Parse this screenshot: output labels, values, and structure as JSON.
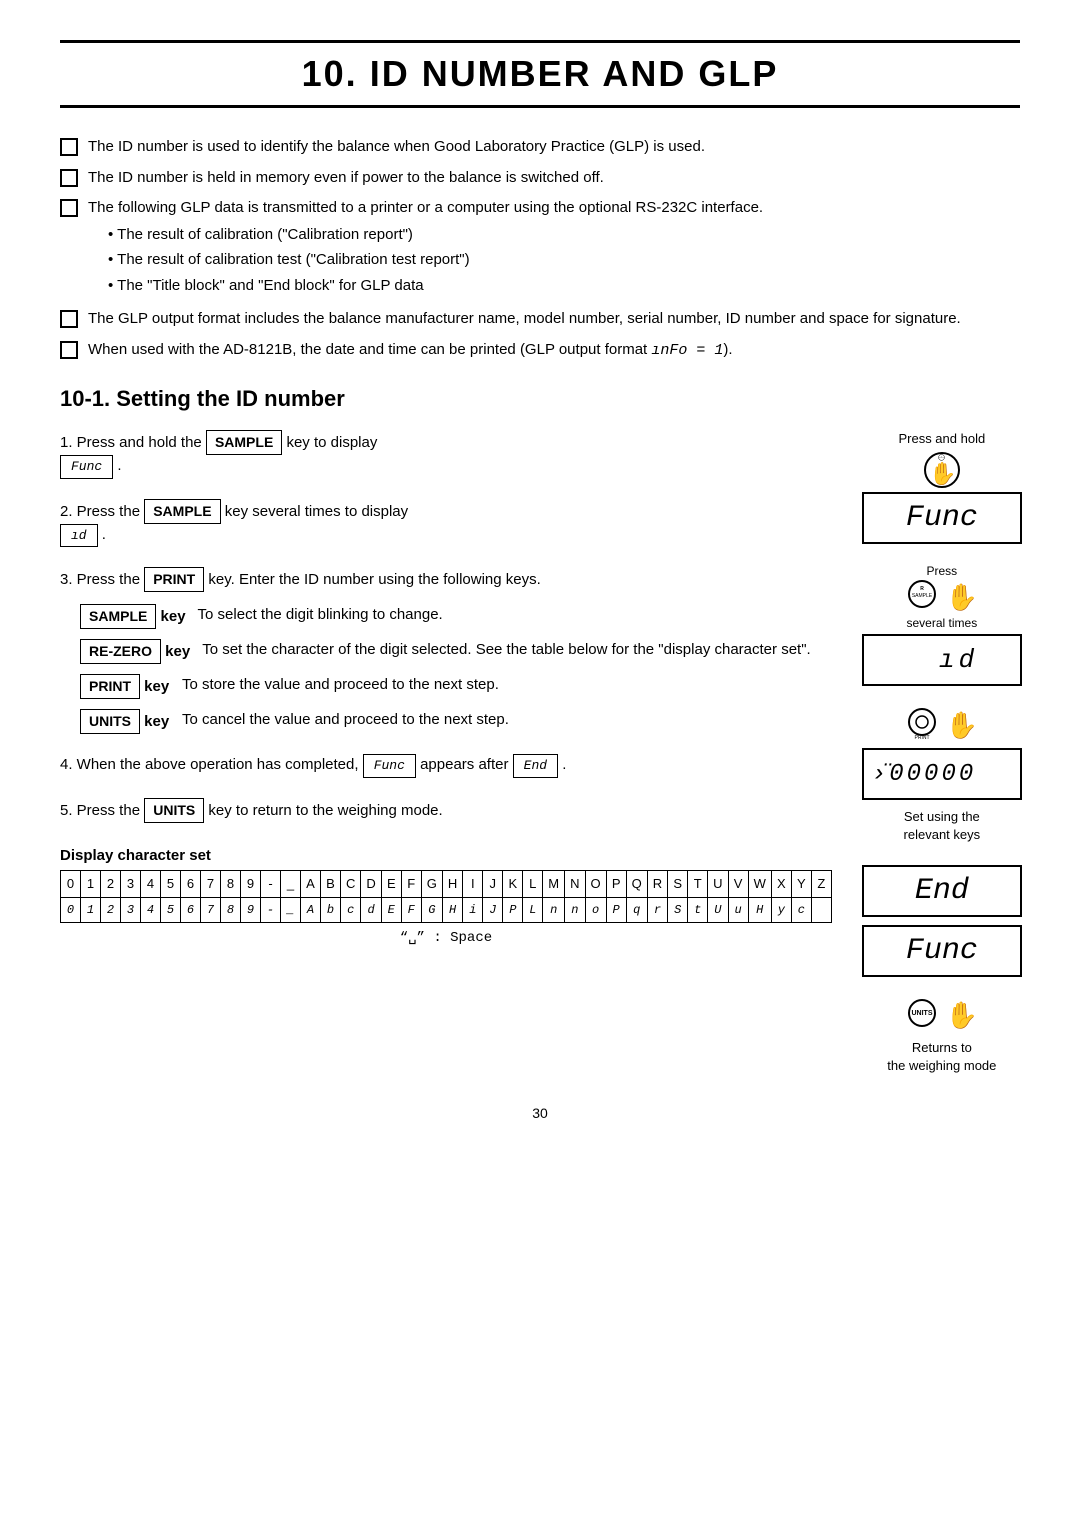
{
  "title": "10. ID NUMBER AND GLP",
  "bullets": [
    {
      "text": "The ID number is used to identify the balance when Good Laboratory Practice (GLP) is used."
    },
    {
      "text": "The ID number is held in memory even if power to the balance is switched off."
    },
    {
      "text": "The following GLP data is transmitted to a printer or a computer using the optional RS-232C interface.",
      "subbullets": [
        "The result of calibration (\"Calibration report\")",
        "The result of calibration test (\"Calibration test report\")",
        "The \"Title block\" and \"End block\" for GLP data"
      ]
    },
    {
      "text": "The GLP output format includes the balance manufacturer name, model number, serial number, ID number and space for signature."
    },
    {
      "text": "When used with the AD-8121B, the date and time can be printed (GLP output format ᵢnF₀ = 1)."
    }
  ],
  "section_heading": "10-1. Setting the ID number",
  "steps": [
    {
      "num": "1",
      "text_before": "Press and hold the",
      "key": "SAMPLE",
      "text_after": "key to display",
      "display": "Func"
    },
    {
      "num": "2",
      "text_before": "Press the",
      "key": "SAMPLE",
      "text_after": "key several times to display",
      "display": "id"
    },
    {
      "num": "3",
      "text_before": "Press the",
      "key": "PRINT",
      "text_after": "key. Enter the ID number using the following keys.",
      "key_table": [
        {
          "key": "SAMPLE",
          "suffix": "key",
          "desc": "To select the digit blinking to change."
        },
        {
          "key": "RE-ZERO",
          "suffix": "key",
          "desc": "To set the character of the digit selected. See the table below for the \"display character set\"."
        },
        {
          "key": "PRINT",
          "suffix": "key",
          "desc": "To store the value and proceed to the next step."
        },
        {
          "key": "UNITS",
          "suffix": "key",
          "desc": "To cancel the value and proceed to the next step."
        }
      ]
    },
    {
      "num": "4",
      "text": "When the above operation has completed,",
      "func_display": "Func",
      "text2": "appears after",
      "end_display": "End"
    },
    {
      "num": "5",
      "text_before": "Press the",
      "key": "UNITS",
      "text_after": "key to return to the weighing mode."
    }
  ],
  "right_column": {
    "press_and_hold_label": "Press and hold",
    "lcd_func": "Func",
    "press_label": "Press",
    "several_times_label": "several times",
    "lcd_id": "id",
    "set_using_label": "Set using the",
    "relevant_keys_label": "relevant keys",
    "lcd_end": "End",
    "lcd_func2": "Func",
    "returns_label": "Returns to",
    "weighing_mode_label": "the weighing mode"
  },
  "display_char_set": {
    "label": "Display character set",
    "top_row": [
      "0",
      "1",
      "2",
      "3",
      "4",
      "5",
      "6",
      "7",
      "8",
      "9",
      "-",
      "_",
      "A",
      "B",
      "C",
      "D",
      "E",
      "F",
      "G",
      "H",
      "I",
      "J",
      "K",
      "L",
      "M",
      "N",
      "O",
      "P",
      "Q",
      "R",
      "S",
      "T",
      "U",
      "V",
      "W",
      "X",
      "Y",
      "Z"
    ],
    "bottom_row": [
      "0",
      "1",
      "2",
      "3",
      "4",
      "5",
      "6",
      "7",
      "8",
      "9",
      "-",
      "_",
      "A",
      "b",
      "c",
      "d",
      "E",
      "F",
      "G",
      "H",
      "i",
      "J",
      "P",
      "L",
      "n",
      "n",
      "o",
      "P",
      "q",
      "r",
      "S",
      "t",
      "U",
      "u",
      "H",
      "y",
      "c",
      ""
    ],
    "space_note": "“␣” : Space"
  },
  "page_number": "30"
}
